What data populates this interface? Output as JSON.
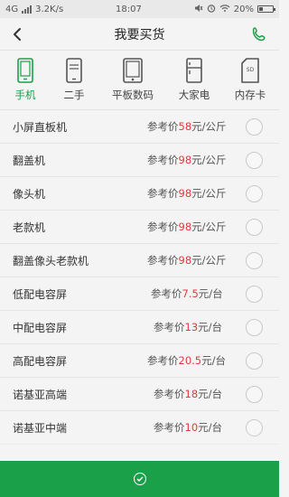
{
  "status": {
    "network": "4G",
    "speed": "3.2K/s",
    "time": "18:07",
    "battery": "20%"
  },
  "header": {
    "title": "我要买货"
  },
  "categories": [
    {
      "label": "手机",
      "icon": "phone-icon",
      "active": true
    },
    {
      "label": "二手",
      "icon": "used-phone-icon",
      "active": false
    },
    {
      "label": "平板数码",
      "icon": "tablet-icon",
      "active": false
    },
    {
      "label": "大家电",
      "icon": "fridge-icon",
      "active": false
    },
    {
      "label": "内存卡",
      "icon": "sd-card-icon",
      "active": false
    }
  ],
  "items": [
    {
      "name": "小屏直板机",
      "prefix": "参考价",
      "price": "58",
      "unit": "元/公斤"
    },
    {
      "name": "翻盖机",
      "prefix": "参考价",
      "price": "98",
      "unit": "元/公斤"
    },
    {
      "name": "像头机",
      "prefix": "参考价",
      "price": "98",
      "unit": "元/公斤"
    },
    {
      "name": "老款机",
      "prefix": "参考价",
      "price": "98",
      "unit": "元/公斤"
    },
    {
      "name": "翻盖像头老款机",
      "prefix": "参考价",
      "price": "98",
      "unit": "元/公斤"
    },
    {
      "name": "低配电容屏",
      "prefix": "参考价",
      "price": "7.5",
      "unit": "元/台"
    },
    {
      "name": "中配电容屏",
      "prefix": "参考价",
      "price": "13",
      "unit": "元/台"
    },
    {
      "name": "高配电容屏",
      "prefix": "参考价",
      "price": "20.5",
      "unit": "元/台"
    },
    {
      "name": "诺基亚高端",
      "prefix": "参考价",
      "price": "18",
      "unit": "元/台"
    },
    {
      "name": "诺基亚中端",
      "prefix": "参考价",
      "price": "10",
      "unit": "元/台"
    }
  ],
  "colors": {
    "accent": "#1aa049",
    "price": "#e4393c"
  }
}
